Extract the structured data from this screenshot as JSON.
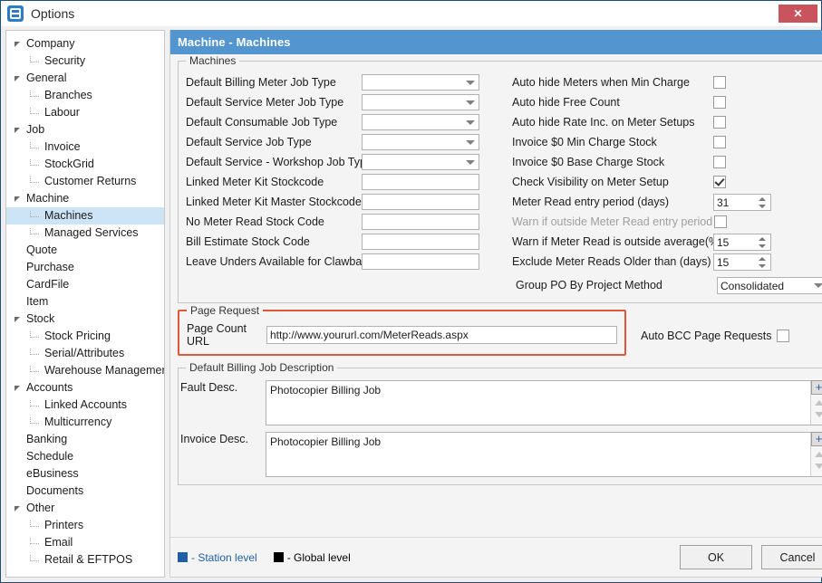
{
  "window": {
    "title": "Options",
    "app_icon": "options-app-icon",
    "close_label": "✕"
  },
  "sidebar": {
    "items": [
      {
        "label": "Company",
        "level": 0,
        "expandable": true,
        "selected": false
      },
      {
        "label": "Security",
        "level": 1,
        "expandable": false,
        "selected": false
      },
      {
        "label": "General",
        "level": 0,
        "expandable": true,
        "selected": false
      },
      {
        "label": "Branches",
        "level": 1,
        "expandable": false,
        "selected": false
      },
      {
        "label": "Labour",
        "level": 1,
        "expandable": false,
        "selected": false
      },
      {
        "label": "Job",
        "level": 0,
        "expandable": true,
        "selected": false
      },
      {
        "label": "Invoice",
        "level": 1,
        "expandable": false,
        "selected": false
      },
      {
        "label": "StockGrid",
        "level": 1,
        "expandable": false,
        "selected": false
      },
      {
        "label": "Customer Returns",
        "level": 1,
        "expandable": false,
        "selected": false
      },
      {
        "label": "Machine",
        "level": 0,
        "expandable": true,
        "selected": false
      },
      {
        "label": "Machines",
        "level": 1,
        "expandable": false,
        "selected": true
      },
      {
        "label": "Managed Services",
        "level": 1,
        "expandable": false,
        "selected": false
      },
      {
        "label": "Quote",
        "level": 0,
        "expandable": false,
        "selected": false
      },
      {
        "label": "Purchase",
        "level": 0,
        "expandable": false,
        "selected": false
      },
      {
        "label": "CardFile",
        "level": 0,
        "expandable": false,
        "selected": false
      },
      {
        "label": "Item",
        "level": 0,
        "expandable": false,
        "selected": false
      },
      {
        "label": "Stock",
        "level": 0,
        "expandable": true,
        "selected": false
      },
      {
        "label": "Stock Pricing",
        "level": 1,
        "expandable": false,
        "selected": false
      },
      {
        "label": "Serial/Attributes",
        "level": 1,
        "expandable": false,
        "selected": false
      },
      {
        "label": "Warehouse Management",
        "level": 1,
        "expandable": false,
        "selected": false
      },
      {
        "label": "Accounts",
        "level": 0,
        "expandable": true,
        "selected": false
      },
      {
        "label": "Linked Accounts",
        "level": 1,
        "expandable": false,
        "selected": false
      },
      {
        "label": "Multicurrency",
        "level": 1,
        "expandable": false,
        "selected": false
      },
      {
        "label": "Banking",
        "level": 0,
        "expandable": false,
        "selected": false
      },
      {
        "label": "Schedule",
        "level": 0,
        "expandable": false,
        "selected": false
      },
      {
        "label": "eBusiness",
        "level": 0,
        "expandable": false,
        "selected": false
      },
      {
        "label": "Documents",
        "level": 0,
        "expandable": false,
        "selected": false
      },
      {
        "label": "Other",
        "level": 0,
        "expandable": true,
        "selected": false
      },
      {
        "label": "Printers",
        "level": 1,
        "expandable": false,
        "selected": false
      },
      {
        "label": "Email",
        "level": 1,
        "expandable": false,
        "selected": false
      },
      {
        "label": "Retail & EFTPOS",
        "level": 1,
        "expandable": false,
        "selected": false
      }
    ]
  },
  "panel": {
    "header": "Machine - Machines"
  },
  "machines_group": {
    "title": "Machines",
    "left_fields": [
      {
        "label": "Default Billing Meter Job Type",
        "value": "",
        "type": "combo"
      },
      {
        "label": "Default Service Meter Job Type",
        "value": "",
        "type": "combo"
      },
      {
        "label": "Default Consumable Job Type",
        "value": "",
        "type": "combo"
      },
      {
        "label": "Default Service Job Type",
        "value": "",
        "type": "combo"
      },
      {
        "label": "Default Service - Workshop Job Type",
        "value": "",
        "type": "combo"
      },
      {
        "label": "Linked Meter Kit Stockcode",
        "value": "",
        "type": "text"
      },
      {
        "label": "Linked Meter Kit Master Stockcode",
        "value": "",
        "type": "text"
      },
      {
        "label": "No Meter Read Stock Code",
        "value": "",
        "type": "text"
      },
      {
        "label": "Bill Estimate Stock Code",
        "value": "",
        "type": "text"
      },
      {
        "label": "Leave Unders Available for Clawback",
        "value": "",
        "type": "text"
      }
    ],
    "checkboxes": [
      {
        "label": "Auto hide Meters when Min Charge",
        "checked": false
      },
      {
        "label": "Auto hide Free Count",
        "checked": false
      },
      {
        "label": "Auto hide Rate Inc. on Meter Setups",
        "checked": false
      },
      {
        "label": "Invoice $0 Min Charge Stock",
        "checked": false
      },
      {
        "label": "Invoice $0 Base Charge Stock",
        "checked": false
      },
      {
        "label": "Check Visibility on Meter Setup",
        "checked": true
      }
    ],
    "meter_read_entry_period": {
      "label": "Meter Read entry period (days)",
      "value": "31"
    },
    "warn_outside_entry_period": {
      "label": "Warn if outside Meter Read entry period",
      "checked": false,
      "disabled": true
    },
    "warn_outside_average": {
      "label": "Warn if Meter Read is outside average(%)",
      "value": "15"
    },
    "exclude_older_than": {
      "label": "Exclude Meter Reads Older than (days)",
      "value": "15"
    },
    "group_po_method": {
      "label": "Group PO By Project Method",
      "value": "Consolidated"
    }
  },
  "page_request": {
    "title": "Page Request",
    "url_label": "Page Count URL",
    "url_value": "http://www.yoururl.com/MeterReads.aspx",
    "bcc_label": "Auto BCC Page Requests",
    "bcc_checked": false,
    "highlight_color": "#e2563c"
  },
  "billing_desc": {
    "title": "Default Billing Job Description",
    "fault_label": "Fault Desc.",
    "fault_value": "Photocopier Billing Job",
    "invoice_label": "Invoice Desc.",
    "invoice_value": "Photocopier Billing Job",
    "plus_label": "+"
  },
  "footer": {
    "legend_station": "- Station level",
    "legend_global": "- Global level",
    "station_color": "#1f5fa8",
    "global_color": "#000000",
    "ok_label": "OK",
    "cancel_label": "Cancel"
  }
}
